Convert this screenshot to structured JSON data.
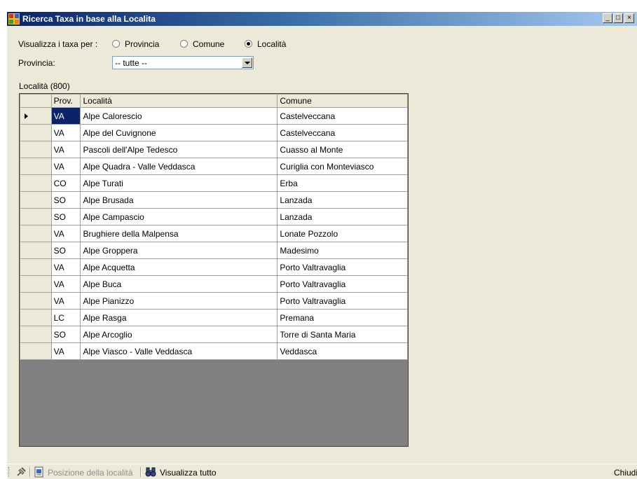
{
  "window": {
    "title": "Ricerca Taxa in base alla Localita",
    "buttons": {
      "minimize": "_",
      "maximize": "□",
      "close": "×"
    }
  },
  "filter": {
    "view_label": "Visualizza i taxa per :",
    "options": [
      {
        "label": "Provincia",
        "checked": false
      },
      {
        "label": "Comune",
        "checked": false
      },
      {
        "label": "Località",
        "checked": true
      }
    ],
    "provincia_label": "Provincia:",
    "provincia_value": "-- tutte --"
  },
  "grid": {
    "count_label": "Località (800)",
    "columns": [
      "Prov.",
      "Località",
      "Comune"
    ],
    "rows": [
      [
        "VA",
        "Alpe Calorescio",
        "Castelveccana"
      ],
      [
        "VA",
        "Alpe del Cuvignone",
        "Castelveccana"
      ],
      [
        "VA",
        "Pascoli dell'Alpe Tedesco",
        "Cuasso al Monte"
      ],
      [
        "VA",
        "Alpe Quadra - Valle Veddasca",
        "Curiglia con Monteviasco"
      ],
      [
        "CO",
        "Alpe Turati",
        "Erba"
      ],
      [
        "SO",
        "Alpe Brusada",
        "Lanzada"
      ],
      [
        "SO",
        "Alpe Campascio",
        "Lanzada"
      ],
      [
        "VA",
        "Brughiere della Malpensa",
        "Lonate Pozzolo"
      ],
      [
        "SO",
        "Alpe Groppera",
        "Madesimo"
      ],
      [
        "VA",
        "Alpe Acquetta",
        "Porto Valtravaglia"
      ],
      [
        "VA",
        "Alpe Buca",
        "Porto Valtravaglia"
      ],
      [
        "VA",
        "Alpe Pianizzo",
        "Porto Valtravaglia"
      ],
      [
        "LC",
        "Alpe Rasga",
        "Premana"
      ],
      [
        "SO",
        "Alpe Arcoglio",
        "Torre di Santa Maria"
      ],
      [
        "VA",
        "Alpe Viasco - Valle Veddasca",
        "Veddasca"
      ]
    ],
    "selected_row": 0
  },
  "statusbar": {
    "position_label": "Posizione della località",
    "show_all_label": "Visualizza tutto",
    "close_label": "Chiudi"
  },
  "icons": [
    "app-icon",
    "pin-icon",
    "document-icon",
    "binoculars-icon"
  ]
}
